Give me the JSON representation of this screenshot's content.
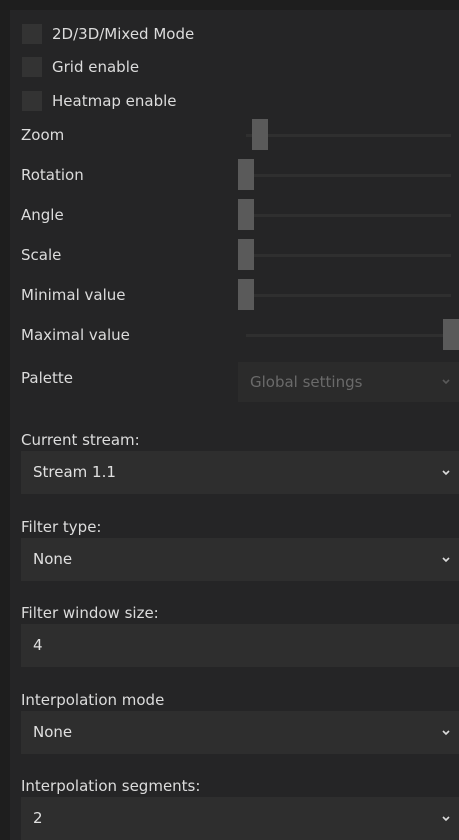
{
  "checkboxes": [
    {
      "label": "2D/3D/Mixed Mode",
      "checked": false
    },
    {
      "label": "Grid enable",
      "checked": false
    },
    {
      "label": "Heatmap enable",
      "checked": false
    }
  ],
  "sliders": [
    {
      "label": "Zoom",
      "value_fraction": 0.07
    },
    {
      "label": "Rotation",
      "value_fraction": 0.0
    },
    {
      "label": "Angle",
      "value_fraction": 0.0
    },
    {
      "label": "Scale",
      "value_fraction": 0.0
    },
    {
      "label": "Minimal value",
      "value_fraction": 0.0
    },
    {
      "label": "Maximal value",
      "value_fraction": 1.0
    }
  ],
  "palette": {
    "label": "Palette",
    "value": "Global settings",
    "enabled": false
  },
  "current_stream": {
    "label": "Current stream:",
    "value": "Stream 1.1"
  },
  "filter_type": {
    "label": "Filter type:",
    "value": "None"
  },
  "filter_window_size": {
    "label": "Filter window size:",
    "value": "4"
  },
  "interpolation_mode": {
    "label": "Interpolation mode",
    "value": "None"
  },
  "interpolation_segments": {
    "label": "Interpolation segments:",
    "value": "2"
  },
  "colors": {
    "background": "#1e1e1e",
    "panel": "#252526",
    "text": "#dcdcdc",
    "disabled_text": "#6a6a6a",
    "handle": "#5a5a5a"
  }
}
